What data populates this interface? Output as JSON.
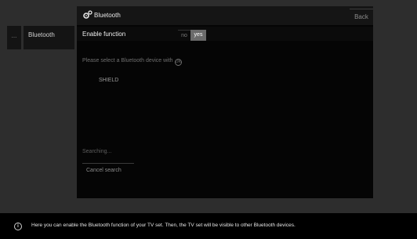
{
  "sidebar": {
    "ellipsis": "...",
    "item_label": "Bluetooth"
  },
  "panel": {
    "title": "Bluetooth",
    "title_icon": "gear-icon",
    "back_label": "Back",
    "enable_label": "Enable function",
    "toggle": {
      "no": "no",
      "yes": "yes",
      "selected": "yes"
    },
    "prompt": "Please select a Bluetooth device with",
    "prompt_icon": "ok-circle-icon",
    "devices": [
      "SHIELD"
    ],
    "status": "Searching...",
    "cancel_label": "Cancel search"
  },
  "info": {
    "icon": "info-icon",
    "text": "Here you can enable the Bluetooth function of your TV set. Then, the TV set will be visible to other Bluetooth devices."
  },
  "colors": {
    "background": "#2d2d2d",
    "panel": "#050505",
    "toggle_selected": "#6b6b6b"
  }
}
